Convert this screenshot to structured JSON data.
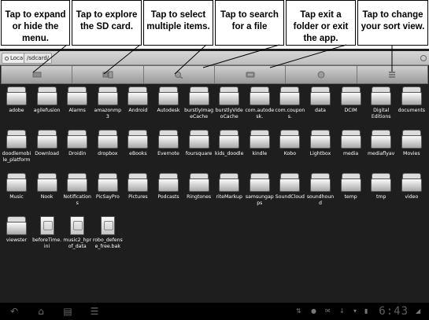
{
  "callouts": [
    {
      "line1": "Tap to expand",
      "line2": "or hide the",
      "line3": "menu."
    },
    {
      "line1": "Tap to explore",
      "line2": "the SD card.",
      "line3": ""
    },
    {
      "line1": "Tap to select",
      "line2": "multiple items.",
      "line3": ""
    },
    {
      "line1": "Tap to search",
      "line2": "for a file",
      "line3": ""
    },
    {
      "line1": "Tap exit a",
      "line2": "folder or exit",
      "line3": "the app."
    },
    {
      "line1": "Tap to change",
      "line2": "your sort view.",
      "line3": ""
    }
  ],
  "pathbar": {
    "local_label": "Local",
    "path_segment": "/sdcard/"
  },
  "toolbar": {
    "buttons": [
      {
        "icon": "menu-icon"
      },
      {
        "icon": "sd-card-icon"
      },
      {
        "icon": "multi-select-icon"
      },
      {
        "icon": "search-icon"
      },
      {
        "icon": "exit-icon"
      },
      {
        "icon": "sort-view-icon"
      }
    ]
  },
  "items": [
    {
      "name": "adobe",
      "type": "folder"
    },
    {
      "name": "agilefusion",
      "type": "folder"
    },
    {
      "name": "Alarms",
      "type": "folder"
    },
    {
      "name": "amazonmp3",
      "type": "folder"
    },
    {
      "name": "Android",
      "type": "folder"
    },
    {
      "name": "Autodesk",
      "type": "folder"
    },
    {
      "name": "burstlyImageCache",
      "type": "folder"
    },
    {
      "name": "burstlyVideoCache",
      "type": "folder"
    },
    {
      "name": "com.autodesk.",
      "type": "folder"
    },
    {
      "name": "com.coupons.",
      "type": "folder"
    },
    {
      "name": "data",
      "type": "folder"
    },
    {
      "name": "DCIM",
      "type": "folder"
    },
    {
      "name": "Digital Editions",
      "type": "folder"
    },
    {
      "name": "documents",
      "type": "folder"
    },
    {
      "name": "doodlemobile_platform",
      "type": "folder"
    },
    {
      "name": "Download",
      "type": "folder"
    },
    {
      "name": "Droidin",
      "type": "folder"
    },
    {
      "name": "dropbox",
      "type": "folder"
    },
    {
      "name": "eBooks",
      "type": "folder"
    },
    {
      "name": "Evernote",
      "type": "folder"
    },
    {
      "name": "foursquare",
      "type": "folder"
    },
    {
      "name": "kids_doodle",
      "type": "folder"
    },
    {
      "name": "kindle",
      "type": "folder"
    },
    {
      "name": "Kobo",
      "type": "folder"
    },
    {
      "name": "Lightbox",
      "type": "folder"
    },
    {
      "name": "media",
      "type": "folder"
    },
    {
      "name": "mediaflyav",
      "type": "folder"
    },
    {
      "name": "Movies",
      "type": "folder"
    },
    {
      "name": "Music",
      "type": "folder"
    },
    {
      "name": "Nook",
      "type": "folder"
    },
    {
      "name": "Notifications",
      "type": "folder"
    },
    {
      "name": "PicSayPro",
      "type": "folder"
    },
    {
      "name": "Pictures",
      "type": "folder"
    },
    {
      "name": "Podcasts",
      "type": "folder"
    },
    {
      "name": "Ringtones",
      "type": "folder"
    },
    {
      "name": "riteMarkup",
      "type": "folder"
    },
    {
      "name": "samsungapps",
      "type": "folder"
    },
    {
      "name": "SoundCloud",
      "type": "folder"
    },
    {
      "name": "soundhound",
      "type": "folder"
    },
    {
      "name": "temp",
      "type": "folder"
    },
    {
      "name": "tmp",
      "type": "folder"
    },
    {
      "name": "video",
      "type": "folder"
    },
    {
      "name": "viewster",
      "type": "folder"
    },
    {
      "name": "beforeTime.ini",
      "type": "file"
    },
    {
      "name": "music2_hprof_data",
      "type": "file"
    },
    {
      "name": "robo_defense_free.bak",
      "type": "file"
    }
  ],
  "statusbar": {
    "time": "6:43"
  }
}
